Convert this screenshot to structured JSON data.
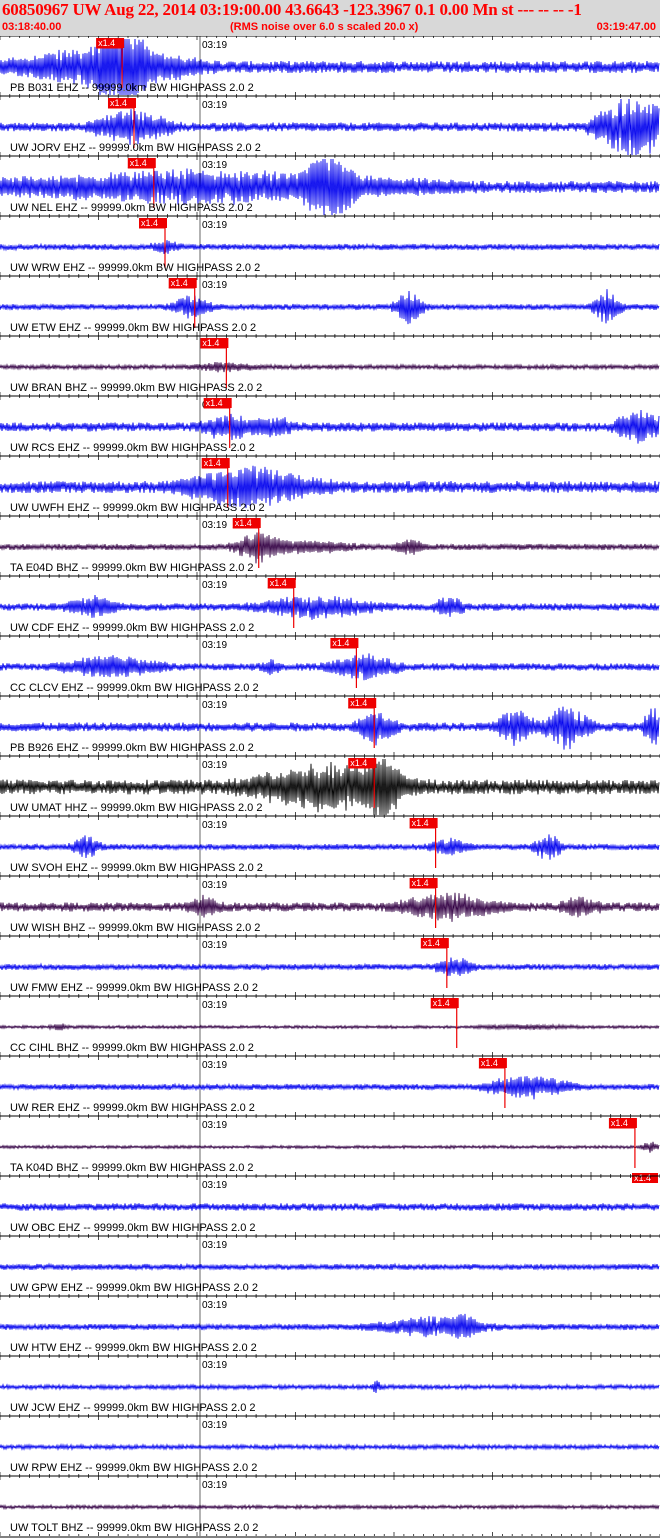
{
  "header": {
    "title": "60850967 UW Aug 22, 2014 03:19:00.00   43.6643 -123.3967  0.1 0.00 Mn st --- -- --  -1",
    "start_time": "03:18:40.00",
    "note": "(RMS noise over 6.0 s scaled 20.0 x)",
    "end_time": "03:19:47.00"
  },
  "minute_label": "03:19",
  "pick_label": "x1.4",
  "traces": [
    {
      "label": "PB B031 EHZ -- 99999.0km BW  HIGHPASS  2.0  2",
      "color": "#0000ee",
      "pick": 0.185,
      "amp": 4,
      "bursts": [
        [
          0.16,
          0.18,
          3.5
        ],
        [
          0.19,
          0.06,
          4.5
        ]
      ]
    },
    {
      "label": "UW JORV EHZ -- 99999.0km BW  HIGHPASS  2.0  2",
      "color": "#0000ee",
      "pick": 0.203,
      "amp": 3,
      "bursts": [
        [
          0.2,
          0.08,
          4
        ],
        [
          0.96,
          0.08,
          8
        ]
      ]
    },
    {
      "label": "UW NEL EHZ -- 99999.0km BW  HIGHPASS  2.0  2",
      "color": "#0000ee",
      "pick": 0.233,
      "amp": 4,
      "bursts": [
        [
          0.3,
          0.45,
          2.5
        ],
        [
          0.5,
          0.05,
          5
        ]
      ]
    },
    {
      "label": "UW WRW EHZ -- 99999.0km BW  HIGHPASS  2.0  2",
      "color": "#0000ee",
      "pick": 0.25,
      "amp": 2,
      "bursts": [
        [
          0.25,
          0.03,
          2
        ]
      ]
    },
    {
      "label": "UW ETW EHZ -- 99999.0km BW  HIGHPASS  2.0  2",
      "color": "#0000ee",
      "pick": 0.295,
      "amp": 2,
      "bursts": [
        [
          0.29,
          0.04,
          4
        ],
        [
          0.62,
          0.03,
          6
        ],
        [
          0.92,
          0.03,
          6
        ]
      ]
    },
    {
      "label": "UW BRAN BHZ -- 99999.0km BW  HIGHPASS  2.0  2",
      "color": "#330044",
      "pick": 0.343,
      "amp": 1.5,
      "bursts": [
        [
          0.34,
          0.06,
          2
        ]
      ]
    },
    {
      "label": "UW RCS EHZ -- 99999.0km BW  HIGHPASS  2.0  2",
      "color": "#0000ee",
      "pick": 0.348,
      "amp": 3,
      "bursts": [
        [
          0.35,
          0.06,
          3
        ],
        [
          0.42,
          0.04,
          2
        ],
        [
          0.97,
          0.05,
          4
        ]
      ]
    },
    {
      "label": "UW UWFH EHZ -- 99999.0km BW  HIGHPASS  2.0  2",
      "color": "#0000ee",
      "pick": 0.345,
      "amp": 4,
      "bursts": [
        [
          0.38,
          0.14,
          3.5
        ]
      ]
    },
    {
      "label": "TA E04D BHZ -- 99999.0km BW  HIGHPASS  2.0  2",
      "color": "#330044",
      "pick": 0.392,
      "amp": 2,
      "bursts": [
        [
          0.39,
          0.05,
          5
        ],
        [
          0.46,
          0.1,
          2
        ],
        [
          0.62,
          0.03,
          2.5
        ]
      ]
    },
    {
      "label": "UW CDF EHZ -- 99999.0km BW  HIGHPASS  2.0  2",
      "color": "#0000ee",
      "pick": 0.445,
      "amp": 2.5,
      "bursts": [
        [
          0.14,
          0.05,
          3
        ],
        [
          0.48,
          0.12,
          3
        ],
        [
          0.68,
          0.03,
          3
        ]
      ]
    },
    {
      "label": "CC CLCV EHZ -- 99999.0km BW  HIGHPASS  2.0  2",
      "color": "#0000ee",
      "pick": 0.54,
      "amp": 2.5,
      "bursts": [
        [
          0.17,
          0.1,
          3
        ],
        [
          0.55,
          0.07,
          3.5
        ],
        [
          0.41,
          0.02,
          2
        ]
      ]
    },
    {
      "label": "PB B926 EHZ -- 99999.0km BW  HIGHPASS  2.0  2",
      "color": "#0000ee",
      "pick": 0.567,
      "amp": 3,
      "bursts": [
        [
          0.57,
          0.04,
          4
        ],
        [
          0.78,
          0.04,
          4
        ],
        [
          0.86,
          0.05,
          5
        ],
        [
          0.99,
          0.02,
          5
        ]
      ]
    },
    {
      "label": "UW UMAT HHZ -- 99999.0km BW  HIGHPASS  2.0  2",
      "color": "#000000",
      "pick": 0.567,
      "amp": 5,
      "bursts": [
        [
          0.5,
          0.16,
          3
        ],
        [
          0.58,
          0.03,
          5
        ]
      ]
    },
    {
      "label": "UW SVOH EHZ -- 99999.0km BW  HIGHPASS  2.0  2",
      "color": "#0000ee",
      "pick": 0.66,
      "amp": 2,
      "bursts": [
        [
          0.13,
          0.03,
          4
        ],
        [
          0.68,
          0.04,
          3
        ],
        [
          0.83,
          0.03,
          5
        ]
      ]
    },
    {
      "label": "UW WISH BHZ -- 99999.0km BW  HIGHPASS  2.0  2",
      "color": "#330044",
      "pick": 0.66,
      "amp": 3,
      "bursts": [
        [
          0.31,
          0.03,
          2.5
        ],
        [
          0.68,
          0.1,
          3
        ],
        [
          0.88,
          0.04,
          2
        ]
      ]
    },
    {
      "label": "UW FMW EHZ -- 99999.0km BW  HIGHPASS  2.0  2",
      "color": "#0000ee",
      "pick": 0.677,
      "amp": 2,
      "bursts": [
        [
          0.69,
          0.04,
          3.5
        ]
      ]
    },
    {
      "label": "CC CIHL BHZ -- 99999.0km BW  HIGHPASS  2.0  2",
      "color": "#330044",
      "pick": 0.692,
      "amp": 1,
      "bursts": [
        [
          0.09,
          0.02,
          2
        ],
        [
          0.8,
          0.1,
          1.3
        ]
      ]
    },
    {
      "label": "UW RER EHZ -- 99999.0km BW  HIGHPASS  2.0  2",
      "color": "#0000ee",
      "pick": 0.765,
      "amp": 2,
      "bursts": [
        [
          0.8,
          0.09,
          4
        ]
      ]
    },
    {
      "label": "TA K04D BHZ -- 99999.0km BW  HIGHPASS  2.0  2",
      "color": "#330044",
      "pick": 0.962,
      "amp": 1,
      "bursts": [
        [
          0.985,
          0.02,
          4
        ]
      ],
      "pick2": true
    },
    {
      "label": "UW OBC EHZ -- 99999.0km BW  HIGHPASS  2.0  2",
      "color": "#0000ee",
      "pick": null,
      "amp": 2.5,
      "bursts": []
    },
    {
      "label": "UW GPW EHZ -- 99999.0km BW  HIGHPASS  2.0  2",
      "color": "#0000ee",
      "pick": null,
      "amp": 2,
      "bursts": []
    },
    {
      "label": "UW HTW EHZ -- 99999.0km BW  HIGHPASS  2.0  2",
      "color": "#0000ee",
      "pick": null,
      "amp": 2,
      "bursts": [
        [
          0.65,
          0.12,
          3
        ],
        [
          0.7,
          0.03,
          3.5
        ]
      ]
    },
    {
      "label": "UW JCW EHZ -- 99999.0km BW  HIGHPASS  2.0  2",
      "color": "#0000ee",
      "pick": null,
      "amp": 1.5,
      "bursts": [
        [
          0.57,
          0.01,
          3
        ]
      ]
    },
    {
      "label": "UW RPW EHZ -- 99999.0km BW  HIGHPASS  2.0  2",
      "color": "#0000ee",
      "pick": null,
      "amp": 1.5,
      "bursts": []
    },
    {
      "label": "UW TOLT BHZ -- 99999.0km BW  HIGHPASS  2.0  2",
      "color": "#330044",
      "pick": null,
      "amp": 1.2,
      "bursts": []
    }
  ]
}
